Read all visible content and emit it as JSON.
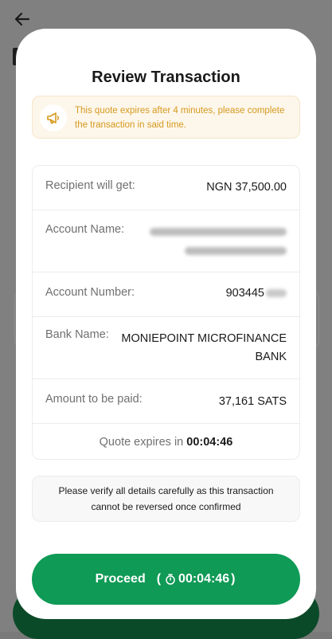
{
  "modal": {
    "title": "Review Transaction",
    "notice": {
      "icon": "megaphone-icon",
      "text": "This quote expires after 4 minutes, please complete the transaction in said time."
    },
    "details": {
      "recipient_label": "Recipient will get:",
      "recipient_value": "NGN 37,500.00",
      "account_name_label": "Account Name:",
      "account_number_label": "Account Number:",
      "account_number_visible": "903445",
      "bank_name_label": "Bank Name:",
      "bank_name_value": "MONIEPOINT MICROFINANCE BANK",
      "amount_label": "Amount to be paid:",
      "amount_value": "37,161 SATS",
      "quote_expires_label": "Quote expires in",
      "quote_expires_time": "00:04:46"
    },
    "warning_text": "Please verify all details carefully as this transaction cannot be reversed once confirmed",
    "proceed": {
      "label": "Proceed",
      "open_paren": "(",
      "timer": "00:04:46",
      "close_paren": ")"
    }
  },
  "colors": {
    "accent_green": "#0f9a56",
    "notice_text": "#d69a1f",
    "notice_bg": "#fdf6ea"
  }
}
